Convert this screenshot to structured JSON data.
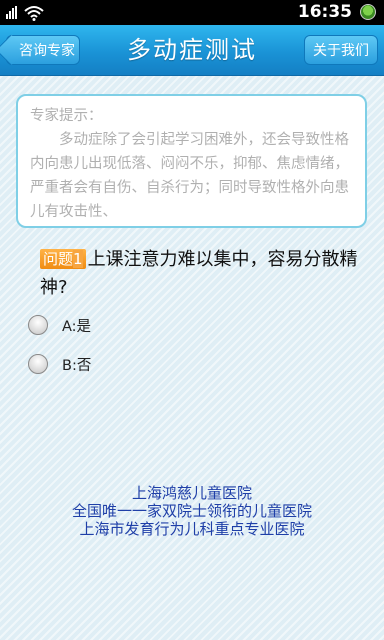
{
  "status_bar": {
    "time": "16:35",
    "icons": [
      "signal-icon",
      "wifi-icon",
      "battery-icon"
    ]
  },
  "title_bar": {
    "back_label": "咨询专家",
    "title": "多动症测试",
    "about_label": "关于我们"
  },
  "tip": {
    "heading": "专家提示：",
    "body": "多动症除了会引起学习困难外，还会导致性格内向患儿出现低落、闷闷不乐，抑郁、焦虑情绪，严重者会有自伤、自杀行为；同时导致性格外向患儿有攻击性、"
  },
  "question": {
    "badge_prefix": "问题",
    "badge_number": "1",
    "text": "上课注意力难以集中，容易分散精神?"
  },
  "options": [
    {
      "label": "A:是"
    },
    {
      "label": "B:否"
    }
  ],
  "footer": {
    "line1": "上海鸿慈儿童医院",
    "line2": "全国唯一一家双院士领衔的儿童医院",
    "line3": "上海市发育行为儿科重点专业医院"
  },
  "colors": {
    "title_bar": "#1a93d6",
    "badge": "#f08c12",
    "footer_text": "#1f3fa8",
    "tip_border": "#7fcfe6"
  }
}
